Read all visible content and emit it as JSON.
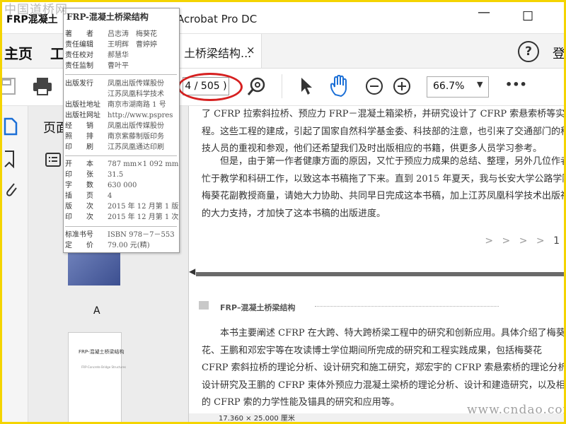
{
  "window": {
    "tab_label": "FRP混凝土",
    "title": "Acrobat Pro DC",
    "minimize": "—",
    "maximize": "☐"
  },
  "menu": {
    "home": "主页",
    "tools": "工",
    "doc_tab": "土桥梁结构...",
    "doc_tab_close": "×",
    "help": "?",
    "login": "登"
  },
  "toolbar": {
    "page_indicator": "4 / 505 )",
    "zoom": "66.7%",
    "more": "•••"
  },
  "pages_panel": {
    "title": "页面",
    "thumb_a_label": "A",
    "thumb_b_title": "FRP-混凝土桥梁结构",
    "thumb_b_subtitle": "FRP-Concrete Bridge Structures"
  },
  "info_card": {
    "title": "FRP-混凝土桥梁结构",
    "rows": [
      {
        "label": "著　　者",
        "value": "吕志涛　梅葵花"
      },
      {
        "label": "责任编辑",
        "value": "王明辉　曹婷婷"
      },
      {
        "label": "责任校对",
        "value": "郝慧华"
      },
      {
        "label": "责任监制",
        "value": "曹叶平"
      },
      {
        "label": "出版发行",
        "value": "凤凰出版传媒股份"
      },
      {
        "label": "",
        "value": "江苏凤凰科学技术"
      },
      {
        "label": "出版社地址",
        "value": "南京市湖南路 1 号"
      },
      {
        "label": "出版社网址",
        "value": "http://www.pspres"
      },
      {
        "label": "经　　销",
        "value": "凤凰出版传媒股份"
      },
      {
        "label": "照　　排",
        "value": "南京紫藤制版印务"
      },
      {
        "label": "印　　刷",
        "value": "江苏凤凰通达印刷"
      },
      {
        "label": "开　　本",
        "value": "787 mm×1 092 mm"
      },
      {
        "label": "印　　张",
        "value": "31.5"
      },
      {
        "label": "字　　数",
        "value": "630 000"
      },
      {
        "label": "插　　页",
        "value": "4"
      },
      {
        "label": "版　　次",
        "value": "2015 年 12 月第 1 版"
      },
      {
        "label": "印　　次",
        "value": "2015 年 12 月第 1 次"
      },
      {
        "label": "标准书号",
        "value": "ISBN 978－7－553"
      },
      {
        "label": "定　　价",
        "value": "79.00 元(精)"
      }
    ]
  },
  "document": {
    "para1": [
      "了 CFRP 拉索斜拉桥、预应力 FRP－混凝土箱梁桥，并研究设计了 CFRP 索悬索桥等实际工",
      "程。这些工程的建成，引起了国家自然科学基金委、科技部的注意，也引来了交通部门的科",
      "技人员的重视和参观，他们还希望我们及时出版相应的书籍，供更多人员学习参考。"
    ],
    "para2": [
      "　　但是，由于第一作者健康方面的原因，又忙于预应力成果的总结、整理，另外几位作者又",
      "忙于教学和科研工作，以致这本书稿拖了下来。直到 2015 年夏天，我与长安大学公路学院",
      "梅葵花副教授商量，请她大力协助、共同早日完成这本书稿，加上江苏凤凰科学技术出版社",
      "的大力支持，才加快了这本书稿的出版进度。"
    ],
    "page_mark_arrows": "> > > >",
    "page_mark_num": "1",
    "page2_header": "FRP–混凝土桥梁结构",
    "para3": [
      "　　本书主要阐述 CFRP 在大跨、特大跨桥梁工程中的研究和创新应用。具体介绍了梅葵",
      "花、王鹏和邓宏宇等在攻读博士学位期间所完成的研究和工程实践成果，包括梅葵花",
      "CFRP 索斜拉桥的理论分析、设计研究和施工研究，郑宏宇的 CFRP 索悬索桥的理论分析",
      "设计研究及王鹏的 CFRP 束体外预应力混凝土梁桥的理论分析、设计和建造研究，以及相",
      "的 CFRP 索的力学性能及锚具的研究和应用等。"
    ],
    "status": "17.360 × 25.000 厘米"
  },
  "watermarks": {
    "top_left": "中国道桥网",
    "bottom_right": "www.cndao.com"
  },
  "colors": {
    "frame": "#f4d400",
    "highlight_oval": "#d62020",
    "hand_tool": "#1b6fd6"
  }
}
